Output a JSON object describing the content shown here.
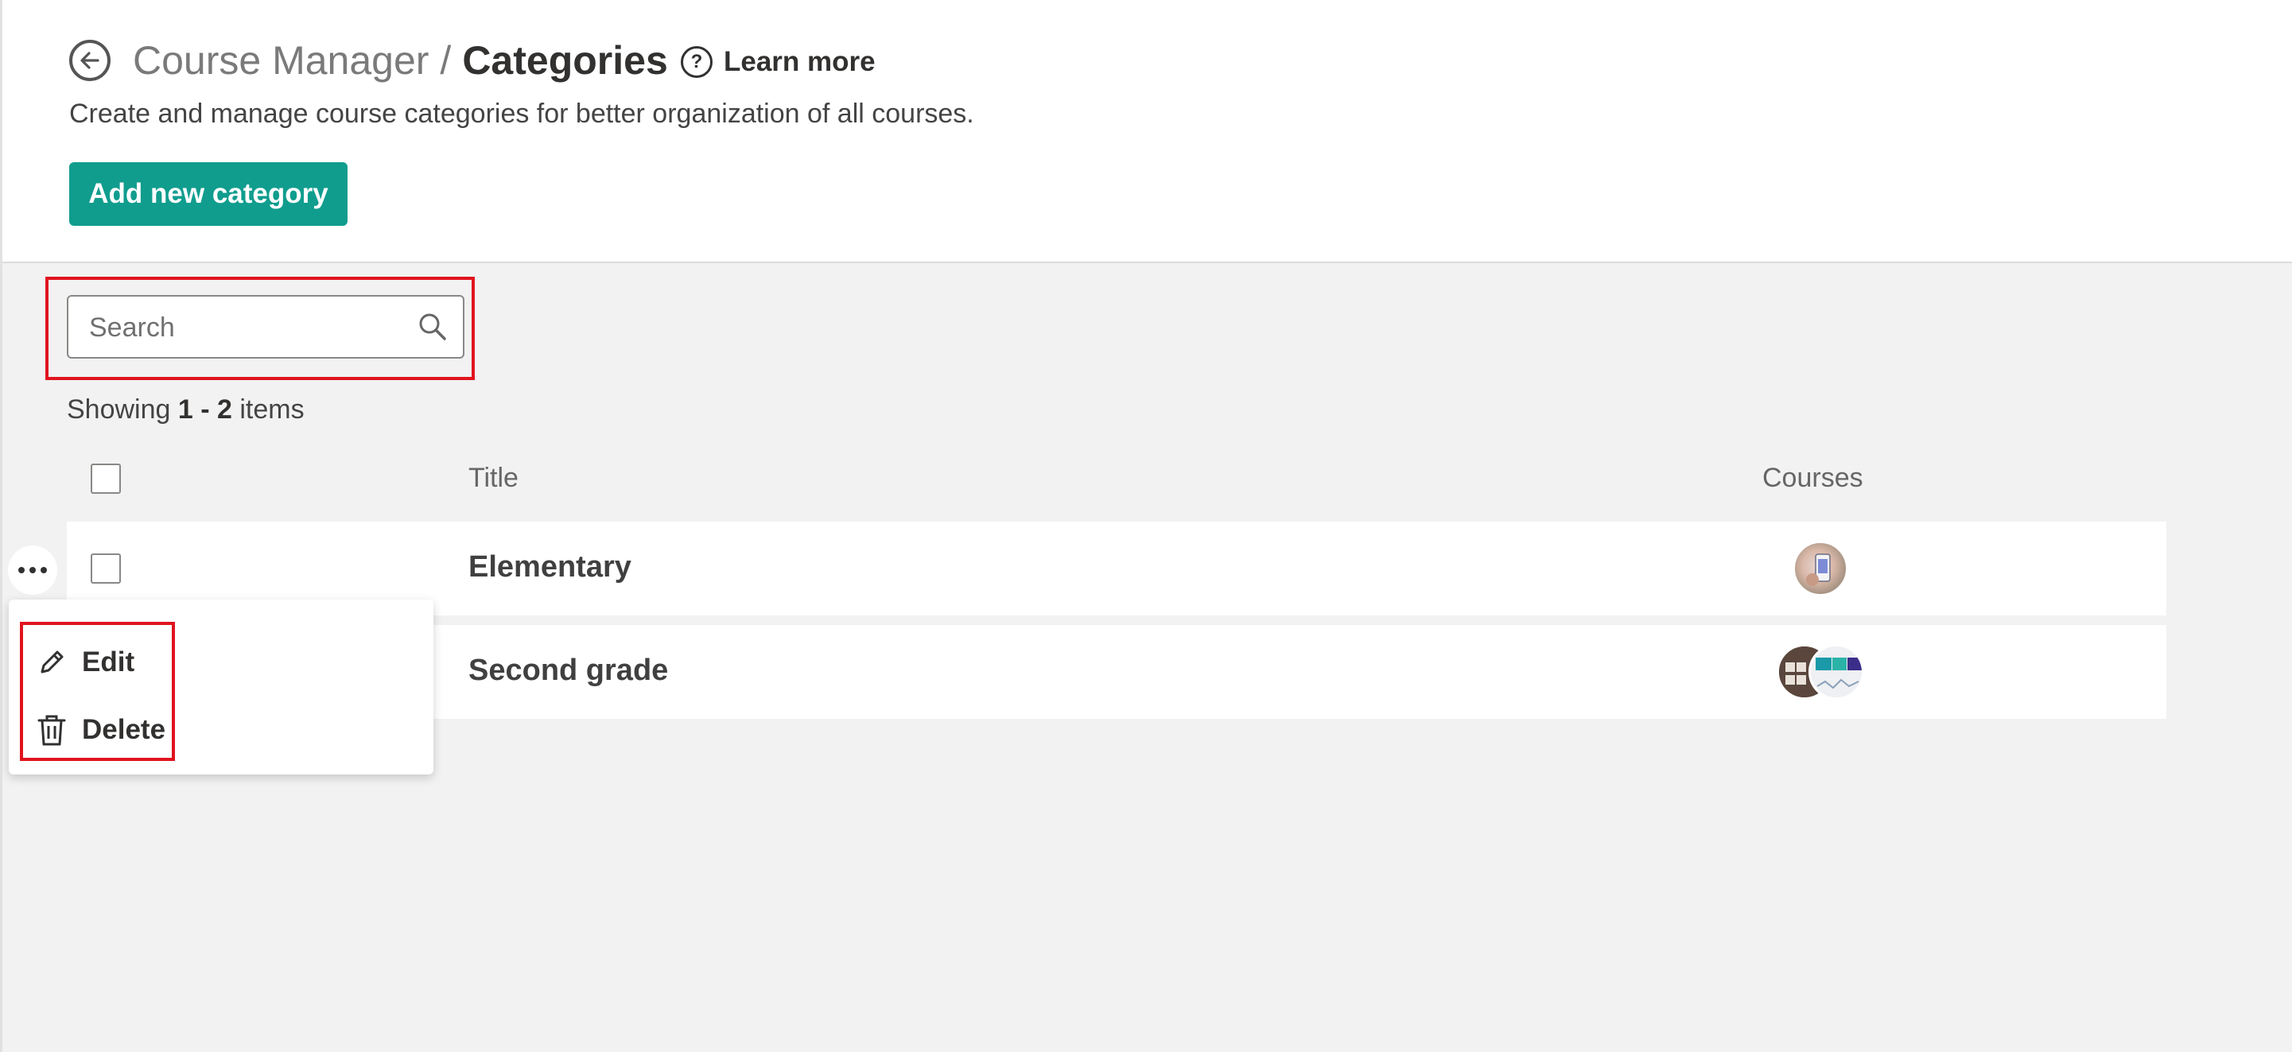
{
  "header": {
    "breadcrumb_parent": "Course Manager",
    "breadcrumb_separator": "/",
    "breadcrumb_current": "Categories",
    "learn_more": "Learn more",
    "subtitle": "Create and manage course categories for better organization of all courses.",
    "add_button": "Add new category"
  },
  "search": {
    "placeholder": "Search",
    "value": ""
  },
  "showing": {
    "prefix": "Showing",
    "range": "1 - 2",
    "suffix": "items"
  },
  "table": {
    "columns": {
      "title": "Title",
      "courses": "Courses"
    },
    "rows": [
      {
        "title": "Elementary"
      },
      {
        "title": "Second grade"
      }
    ]
  },
  "context_menu": {
    "more_icon": "more-horizontal-icon",
    "items": [
      {
        "label": "Edit",
        "icon": "pencil-icon"
      },
      {
        "label": "Delete",
        "icon": "trash-icon"
      }
    ]
  },
  "colors": {
    "accent": "#109d8e",
    "highlight": "#e0141e",
    "background": "#f2f2f2"
  }
}
